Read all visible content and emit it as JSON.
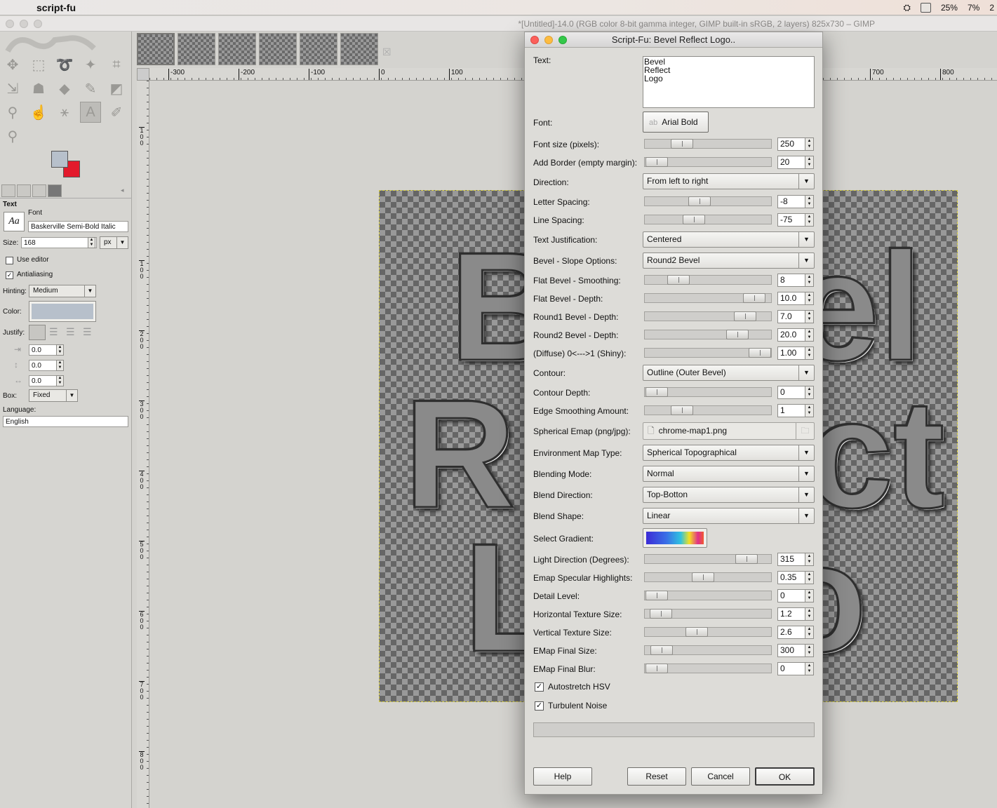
{
  "menubar": {
    "app_name": "script-fu",
    "battery": "25%",
    "cpu": "7%",
    "clock_partial": "2"
  },
  "window_title": "*[Untitled]-14.0 (RGB color 8-bit gamma integer, GIMP built-in sRGB, 2 layers) 825x730 – GIMP",
  "toolbox": {
    "section_title": "Text",
    "font_label": "Font",
    "font_preview": "Aa",
    "font_value": "Baskerville Semi-Bold Italic",
    "size_label": "Size:",
    "size_value": "168",
    "size_unit": "px",
    "use_editor": "Use editor",
    "antialiasing": "Antialiasing",
    "hinting_label": "Hinting:",
    "hinting_value": "Medium",
    "color_label": "Color:",
    "justify_label": "Justify:",
    "indent_value": "0.0",
    "line_spacing_value": "0.0",
    "letter_spacing_value": "0.0",
    "box_label": "Box:",
    "box_value": "Fixed",
    "language_label": "Language:",
    "language_value": "English",
    "fg_color": "#b7c0cb",
    "bg_color": "#e31a2c"
  },
  "hruler": [
    "-300",
    "-200",
    "-100",
    "0",
    "100",
    "700",
    "800"
  ],
  "vruler": [
    "1 0 0",
    "1 0 0",
    "2 0 0",
    "3 0 0",
    "4 0 0",
    "5 0 0",
    "6 0 0",
    "7 0 0",
    "8 0 0"
  ],
  "canvas_letters": [
    "B",
    "R",
    "L",
    "el",
    "ct",
    "o"
  ],
  "dialog": {
    "title": "Script-Fu: Bevel Reflect Logo..",
    "text_label": "Text:",
    "text_value": "Bevel\nReflect\nLogo",
    "font_label": "Font:",
    "font_value": "Arial Bold",
    "font_size_label": "Font size (pixels):",
    "font_size_value": "250",
    "border_label": "Add Border (empty margin):",
    "border_value": "20",
    "direction_label": "Direction:",
    "direction_value": "From left to right",
    "letter_spacing_label": "Letter Spacing:",
    "letter_spacing_value": "-8",
    "line_spacing_label": "Line Spacing:",
    "line_spacing_value": "-75",
    "justification_label": "Text Justification:",
    "justification_value": "Centered",
    "slope_label": "Bevel - Slope Options:",
    "slope_value": "Round2 Bevel",
    "flat_smoothing_label": "Flat Bevel - Smoothing:",
    "flat_smoothing_value": "8",
    "flat_depth_label": "Flat Bevel - Depth:",
    "flat_depth_value": "10.0",
    "round1_label": "Round1 Bevel - Depth:",
    "round1_value": "7.0",
    "round2_label": "Round2 Bevel - Depth:",
    "round2_value": "20.0",
    "diffuse_label": "(Diffuse) 0<--->1 (Shiny):",
    "diffuse_value": "1.00",
    "contour_label": "Contour:",
    "contour_value": "Outline (Outer Bevel)",
    "contour_depth_label": "Contour Depth:",
    "contour_depth_value": "0",
    "edge_label": "Edge Smoothing Amount:",
    "edge_value": "1",
    "emap_label": "Spherical Emap (png/jpg):",
    "emap_value": "chrome-map1.png",
    "envmap_label": "Environment Map Type:",
    "envmap_value": "Spherical Topographical",
    "blend_mode_label": "Blending Mode:",
    "blend_mode_value": "Normal",
    "blend_dir_label": "Blend Direction:",
    "blend_dir_value": "Top-Botton",
    "blend_shape_label": "Blend Shape:",
    "blend_shape_value": "Linear",
    "gradient_label": "Select Gradient:",
    "light_dir_label": "Light Direction (Degrees):",
    "light_dir_value": "315",
    "specular_label": "Emap Specular Highlights:",
    "specular_value": "0.35",
    "detail_label": "Detail Level:",
    "detail_value": "0",
    "htex_label": "Horizontal Texture Size:",
    "htex_value": "1.2",
    "vtex_label": "Vertical Texture Size:",
    "vtex_value": "2.6",
    "emap_size_label": "EMap Final Size:",
    "emap_size_value": "300",
    "emap_blur_label": "EMap Final Blur:",
    "emap_blur_value": "0",
    "autostretch_label": "Autostretch HSV",
    "turbulent_label": "Turbulent Noise",
    "help": "Help",
    "reset": "Reset",
    "cancel": "Cancel",
    "ok": "OK"
  }
}
